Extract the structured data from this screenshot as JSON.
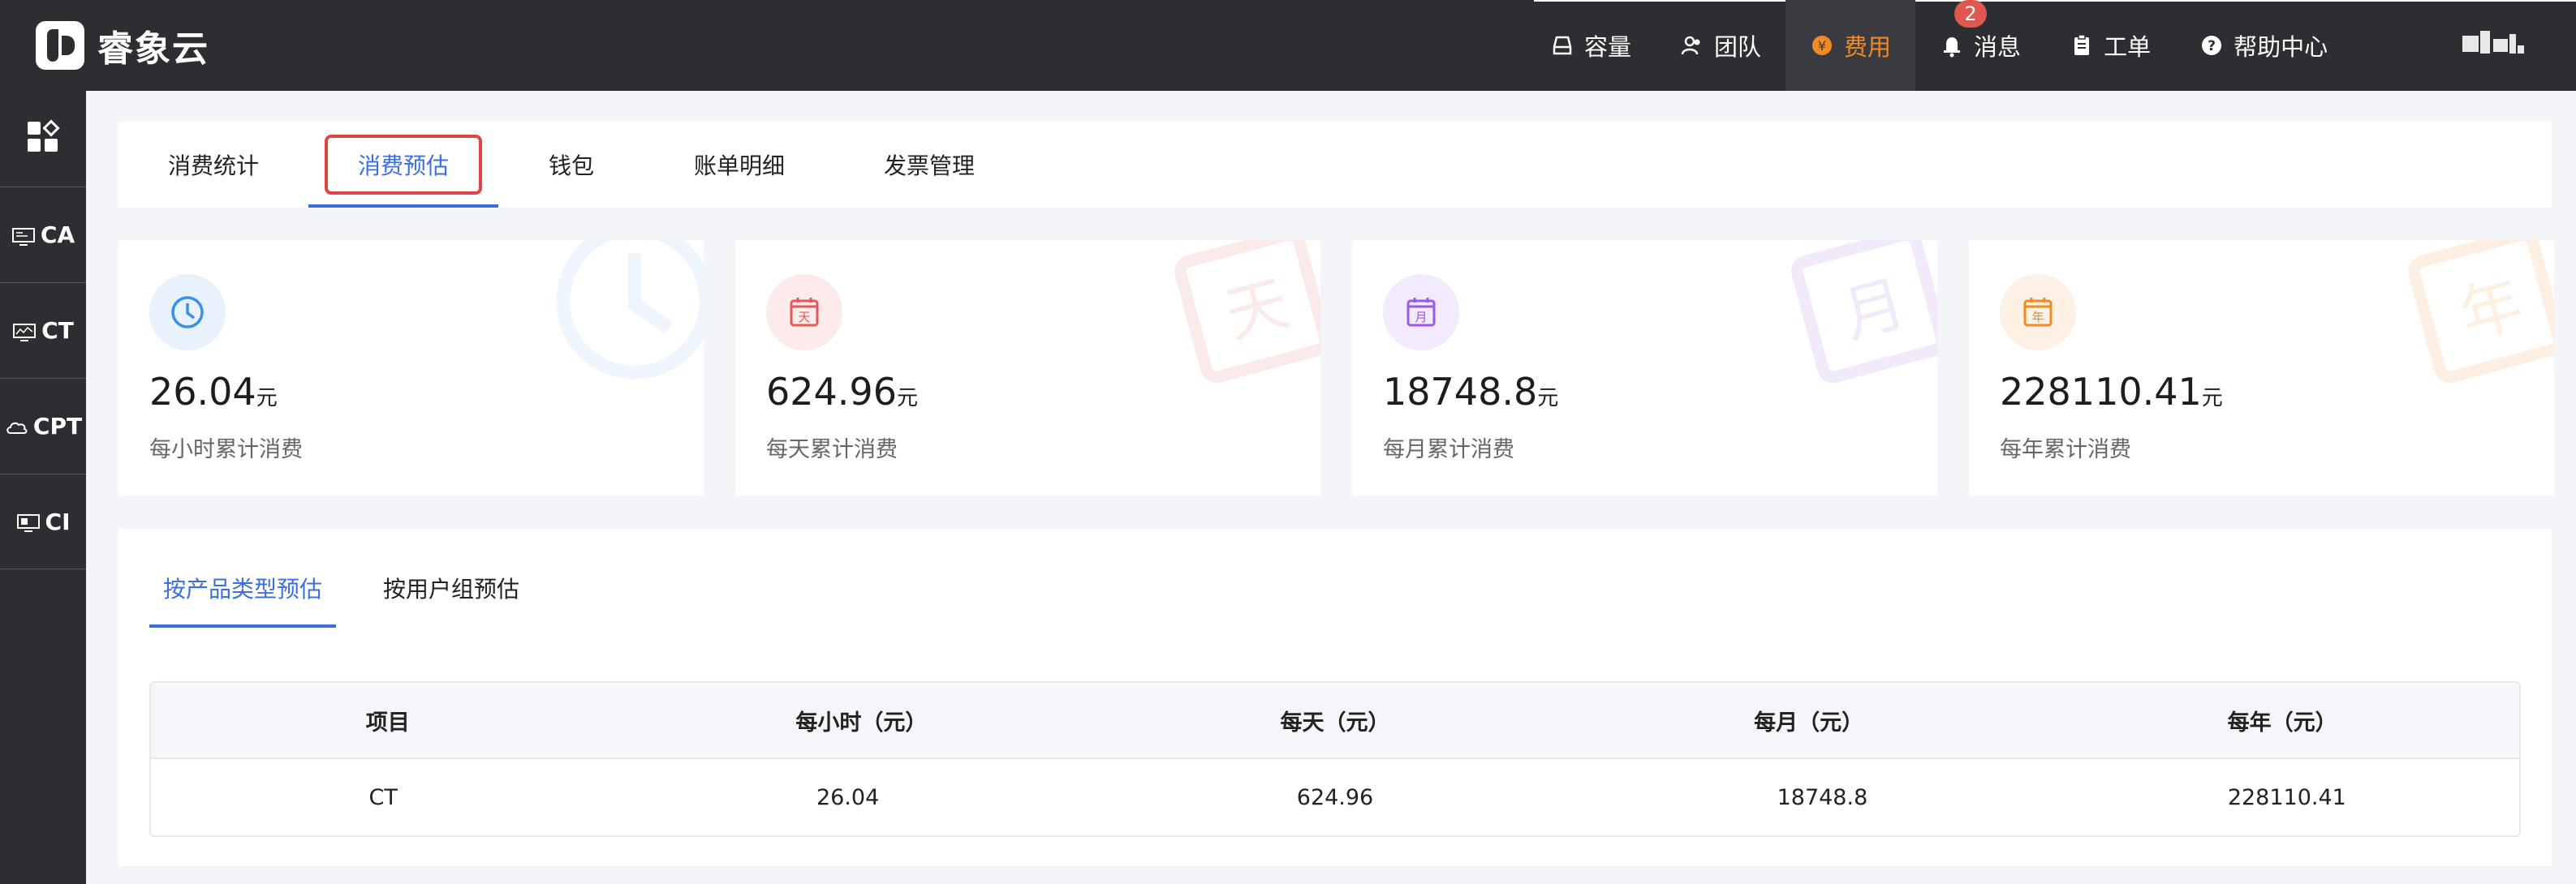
{
  "app": {
    "name": "睿象云"
  },
  "nav": {
    "items": [
      {
        "label": "容量",
        "icon": "storage-icon"
      },
      {
        "label": "团队",
        "icon": "team-icon"
      },
      {
        "label": "费用",
        "icon": "yen-coin-icon",
        "active": true
      },
      {
        "label": "消息",
        "icon": "bell-icon",
        "badge": "2"
      },
      {
        "label": "工单",
        "icon": "clipboard-icon"
      },
      {
        "label": "帮助中心",
        "icon": "help-icon"
      }
    ]
  },
  "sidebar": {
    "items": [
      {
        "label": "CA",
        "icon": "monitor-icon"
      },
      {
        "label": "CT",
        "icon": "monitor-chart-icon"
      },
      {
        "label": "CPT",
        "icon": "cloud-icon"
      },
      {
        "label": "CI",
        "icon": "monitor-icon"
      }
    ]
  },
  "tabs": [
    {
      "label": "消费统计"
    },
    {
      "label": "消费预估",
      "active": true
    },
    {
      "label": "钱包"
    },
    {
      "label": "账单明细"
    },
    {
      "label": "发票管理"
    }
  ],
  "stats": [
    {
      "value": "26.04",
      "unit": "元",
      "label": "每小时累计消费",
      "icon": "clock-icon",
      "color": "#3b8fe6",
      "bg": "#e8f2fd"
    },
    {
      "value": "624.96",
      "unit": "元",
      "label": "每天累计消费",
      "icon": "calendar-day-icon",
      "icon_char": "天",
      "color": "#e05a5a",
      "bg": "#fdeaea"
    },
    {
      "value": "18748.8",
      "unit": "元",
      "label": "每月累计消费",
      "icon": "calendar-month-icon",
      "icon_char": "月",
      "color": "#9b5ae6",
      "bg": "#f2eafd"
    },
    {
      "value": "228110.41",
      "unit": "元",
      "label": "每年累计消费",
      "icon": "calendar-year-icon",
      "icon_char": "年",
      "color": "#f08a24",
      "bg": "#fdf0e4"
    }
  ],
  "estimate": {
    "subtabs": [
      {
        "label": "按产品类型预估",
        "active": true
      },
      {
        "label": "按用户组预估"
      }
    ],
    "table": {
      "headers": [
        "项目",
        "每小时（元）",
        "每天（元）",
        "每月（元）",
        "每年（元）"
      ],
      "rows": [
        [
          "CT",
          "26.04",
          "624.96",
          "18748.8",
          "228110.41"
        ]
      ]
    }
  },
  "colors": {
    "accent": "#3b6fe0",
    "topbar": "#2d2e31",
    "nav_active": "#f08a24",
    "highlight": "#e04545"
  }
}
